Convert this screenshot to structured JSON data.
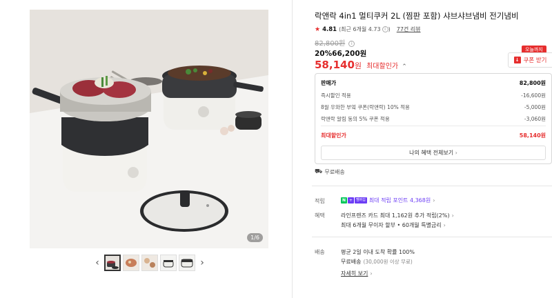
{
  "product": {
    "title": "락앤락 4in1 멀티쿠커 2L (찜판 포함) 샤브샤브냄비 전기냄비",
    "rating": "4.81",
    "rating_detail": "(최근 6개월 4.73",
    "rating_close": ")",
    "review_count": "77건 리뷰",
    "original_price": "82,800원",
    "discount_rate": "20%",
    "sale_price": "66,200원",
    "max_discount_price": "58,140",
    "max_discount_unit": "원",
    "max_discount_label": "최대할인가"
  },
  "coupon": {
    "tag": "오늘까지",
    "label": "쿠폰 받기",
    "icon": "download-icon"
  },
  "gallery": {
    "pager": "1/6",
    "thumbnail_count": 5,
    "active_thumbnail": 1
  },
  "breakdown": {
    "rows": [
      {
        "label": "판매가",
        "value": "82,800원"
      },
      {
        "label": "즉시할인 적용",
        "value": "-16,600원"
      },
      {
        "label": "8월 우와한 부엌 쿠폰(락앤락) 10% 적용",
        "value": "-5,000원"
      },
      {
        "label": "락앤락 알림 동의 5% 쿠폰 적용",
        "value": "-3,060원"
      }
    ],
    "total_label": "최대할인가",
    "total_value": "58,140원",
    "benefit_button": "나의 혜택 전체보기"
  },
  "shipping": {
    "free_label": "무료배송"
  },
  "points": {
    "label": "적립",
    "badge_n": "N",
    "badge_plus": "+",
    "badge_member": "멤버십",
    "text": "최대 적립 포인트 4,368원"
  },
  "benefits": {
    "label": "혜택",
    "line1": "라인프렌즈 카드 최대 1,162원 추가 적립(2%)",
    "line2": "최대 6개월 무이자 할부 • 60개월 특별금리"
  },
  "delivery": {
    "label": "배송",
    "line1": "평균 2일 이내 도착 확률 100%",
    "line2_main": "무료배송",
    "line2_sub": "(30,000원 이상 무료)",
    "details_link": "자세히 보기"
  },
  "colors": {
    "accent_red": "#e62e2e",
    "naver_green": "#03c75a",
    "membership_purple": "#6c3df5"
  }
}
